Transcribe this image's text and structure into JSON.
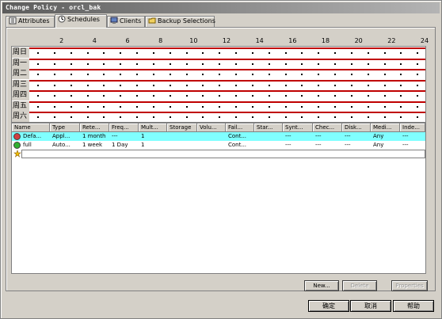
{
  "window": {
    "title": "Change Policy - orcl_bak"
  },
  "tabs": [
    {
      "label": "Attributes",
      "icon": "attributes-icon"
    },
    {
      "label": "Schedules",
      "icon": "clock-icon"
    },
    {
      "label": "Clients",
      "icon": "clients-icon"
    },
    {
      "label": "Backup Selections",
      "icon": "folder-icon"
    }
  ],
  "schedule_grid": {
    "hours": [
      "2",
      "4",
      "6",
      "8",
      "10",
      "12",
      "14",
      "16",
      "18",
      "20",
      "22",
      "24"
    ],
    "days": [
      "周日",
      "周一",
      "周二",
      "周三",
      "周四",
      "周五",
      "周六"
    ]
  },
  "table": {
    "columns": [
      "Name",
      "Type",
      "Rete...",
      "Freq...",
      "Mult...",
      "Storage",
      "Volu...",
      "Fail...",
      "Star...",
      "Synt...",
      "Chec...",
      "Disk...",
      "Medi...",
      "Inde..."
    ],
    "rows": [
      {
        "cells": [
          "Defa...",
          "Appl...",
          "1 month",
          "---",
          "1",
          "",
          "",
          "Cont...",
          "",
          "---",
          "---",
          "---",
          "Any",
          "---"
        ],
        "icon_color": "#d04040"
      },
      {
        "cells": [
          "full",
          "Auto...",
          "1 week",
          "1 Day",
          "1",
          "",
          "",
          "Cont...",
          "",
          "---",
          "---",
          "---",
          "Any",
          "---"
        ],
        "icon_color": "#30b030"
      }
    ]
  },
  "actions": {
    "new": "New...",
    "delete": "Delete",
    "properties": "Properties"
  },
  "footer": {
    "ok": "确定",
    "cancel": "取消",
    "help": "帮助"
  },
  "colors": {
    "selected_row": "#80ffff",
    "schedule_line": "#c00000",
    "titlebar": "#5c5c5c"
  }
}
